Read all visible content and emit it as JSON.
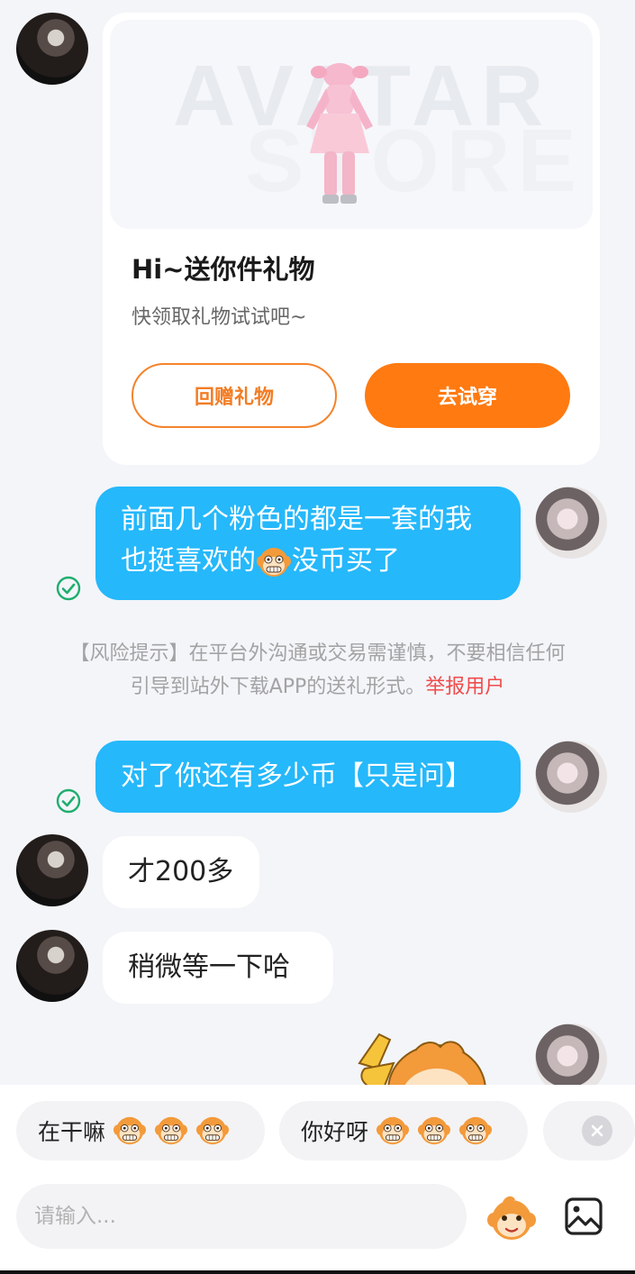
{
  "gift_card": {
    "banner_words": [
      "AVATAR",
      "STORE"
    ],
    "title": "Hi~送你件礼物",
    "subtitle": "快领取礼物试试吧~",
    "return_gift_label": "回赠礼物",
    "try_on_label": "去试穿"
  },
  "messages": {
    "msg1_line1": "前面几个粉色的都是一套的我",
    "msg1_line2_a": "也挺喜欢的",
    "msg1_line2_b": "没币买了",
    "msg2": "对了你还有多少币【只是问】",
    "msg3": "才200多",
    "msg4": "稍微等一下哈"
  },
  "risk_notice": {
    "line1": "【风险提示】在平台外沟通或交易需谨慎，不要相信任何",
    "line2": "引导到站外下载APP的送礼形式。",
    "report_link": "举报用户"
  },
  "quick_replies": {
    "reply1": "在干嘛",
    "reply2": "你好呀"
  },
  "composer": {
    "placeholder": "请输入..."
  },
  "colors": {
    "accent_orange": "#ff7a11",
    "bubble_blue": "#25b8fb",
    "read_check_green": "#1fae6e",
    "report_red": "#f04b4b"
  },
  "icons": [
    "read-check-icon",
    "monkey-emoji-icon",
    "close-icon",
    "emoji-picker-icon",
    "image-picker-icon"
  ]
}
